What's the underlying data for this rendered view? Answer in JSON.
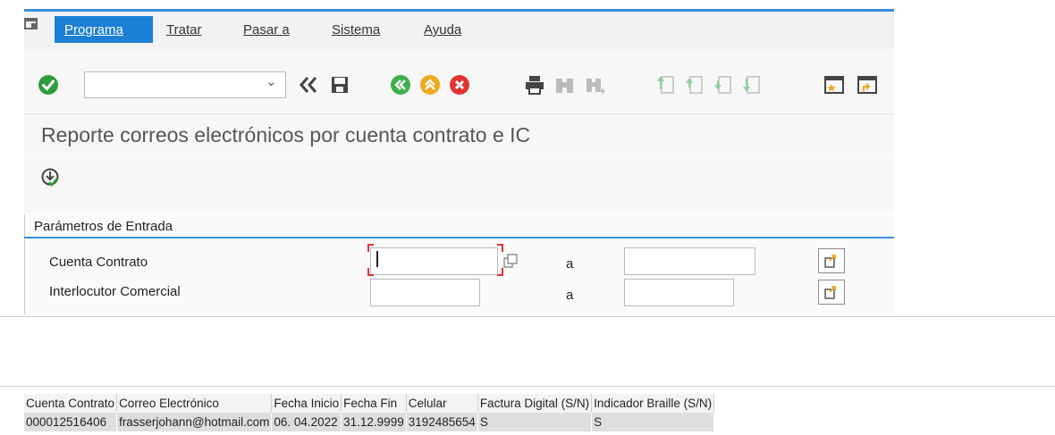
{
  "menu": {
    "items": [
      "Programa",
      "Tratar",
      "Pasar a",
      "Sistema",
      "Ayuda"
    ]
  },
  "toolbar": {
    "command_value": "",
    "icons": [
      "confirm-icon",
      "back-double-icon",
      "save-icon",
      "back-icon",
      "exit-icon",
      "cancel-icon",
      "print-icon",
      "find-icon",
      "find-next-icon",
      "first-page-icon",
      "previous-page-icon",
      "next-page-icon",
      "last-page-icon",
      "create-session-icon",
      "shortcut-icon"
    ],
    "colors": {
      "confirm": "#2e9d3a",
      "back": "#3bb04a",
      "exit": "#f0a81c",
      "cancel": "#e0332f",
      "accent": "#1b7fd6"
    }
  },
  "page": {
    "title": "Reporte correos electrónicos por cuenta contrato e IC"
  },
  "params": {
    "frame_title": "Parámetros de Entrada",
    "rows": [
      {
        "label": "Cuenta Contrato",
        "from": "",
        "to_label": "a",
        "to": ""
      },
      {
        "label": "Interlocutor Comercial",
        "from": "",
        "to_label": "a",
        "to": ""
      }
    ]
  },
  "result": {
    "columns": [
      "Cuenta Contrato",
      "Correo Electrónico",
      "Fecha Inicio",
      "Fecha Fin",
      "Celular",
      "Factura Digital (S/N)",
      "Indicador Braille (S/N)"
    ],
    "rows": [
      [
        "000012516406",
        "frasserjohann@hotmail.com",
        "06. 04.2022",
        "31.12.9999",
        "3192485654",
        "S",
        "S"
      ]
    ]
  }
}
